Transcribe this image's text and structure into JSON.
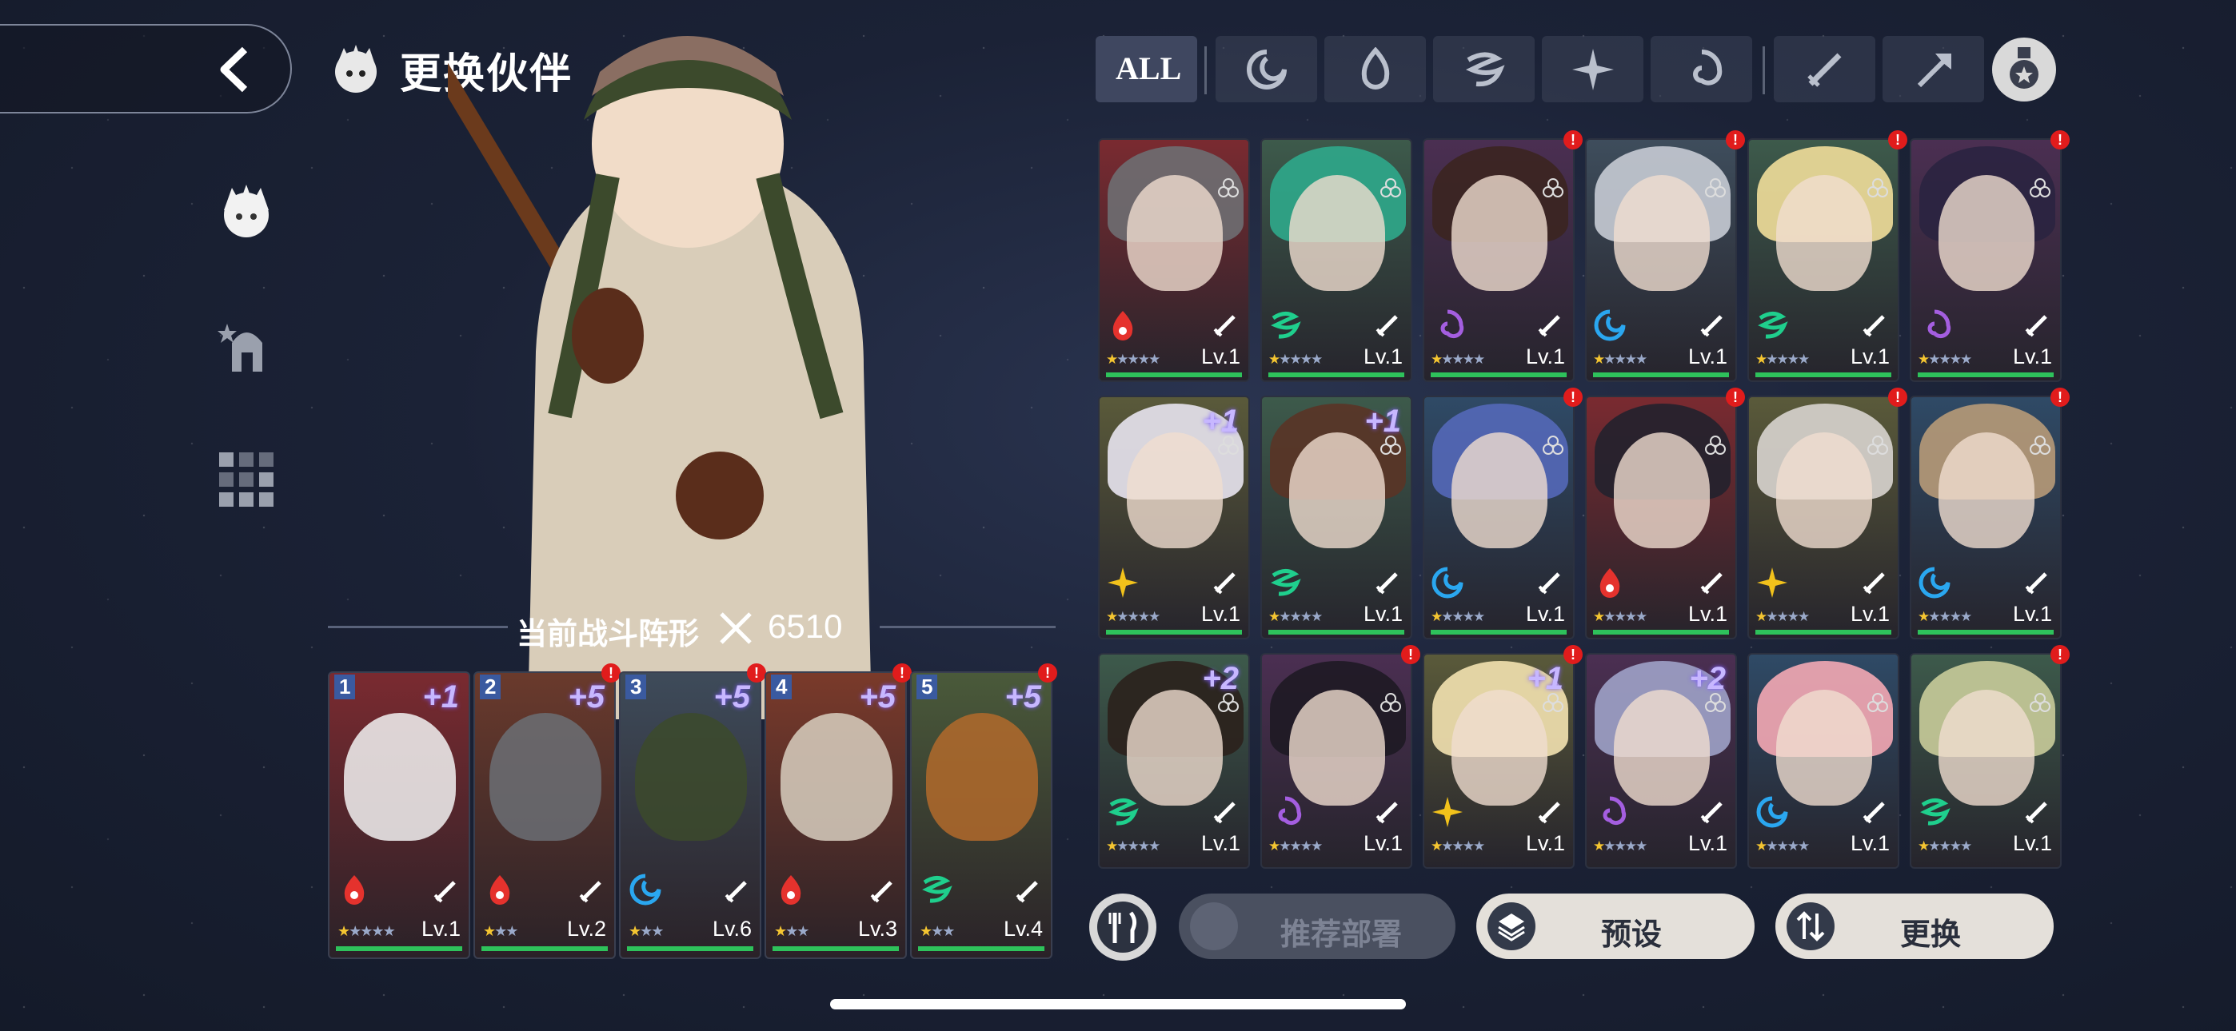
{
  "header": {
    "title": "更换伙伴"
  },
  "formation": {
    "label": "当前战斗阵形",
    "power": "6510"
  },
  "filters": {
    "all_label": "ALL",
    "element_icons": [
      "water-element-icon",
      "fire-element-icon",
      "wind-element-icon",
      "light-element-icon",
      "dark-element-icon"
    ],
    "class_icons": [
      "sword-class-icon",
      "axe-class-icon"
    ]
  },
  "team": [
    {
      "slot": "1",
      "plus": "+1",
      "level": "Lv.1",
      "element": "fire",
      "stars": "★★★★★",
      "lit": 1,
      "notify": false
    },
    {
      "slot": "2",
      "plus": "+5",
      "level": "Lv.2",
      "element": "fire",
      "stars": "★★★",
      "lit": 1,
      "notify": true
    },
    {
      "slot": "3",
      "plus": "+5",
      "level": "Lv.6",
      "element": "water",
      "stars": "★★★",
      "lit": 1,
      "notify": true
    },
    {
      "slot": "4",
      "plus": "+5",
      "level": "Lv.3",
      "element": "fire",
      "stars": "★★★",
      "lit": 1,
      "notify": true
    },
    {
      "slot": "5",
      "plus": "+5",
      "level": "Lv.4",
      "element": "wind",
      "stars": "★★★",
      "lit": 1,
      "notify": true
    }
  ],
  "roster": [
    {
      "plus": "",
      "level": "Lv.1",
      "element": "fire",
      "notify": false,
      "bg": "#7a2a30",
      "hair": "#6e6e72"
    },
    {
      "plus": "",
      "level": "Lv.1",
      "element": "wind",
      "notify": false,
      "bg": "#3d5a4b",
      "hair": "#2fa88b"
    },
    {
      "plus": "",
      "level": "Lv.1",
      "element": "dark",
      "notify": true,
      "bg": "#4b2f52",
      "hair": "#3b2520"
    },
    {
      "plus": "",
      "level": "Lv.1",
      "element": "water",
      "notify": true,
      "bg": "#3e4d5c",
      "hair": "#c7cbd4"
    },
    {
      "plus": "",
      "level": "Lv.1",
      "element": "wind",
      "notify": true,
      "bg": "#3d5a4b",
      "hair": "#f1de9a"
    },
    {
      "plus": "",
      "level": "Lv.1",
      "element": "dark",
      "notify": true,
      "bg": "#4b2f52",
      "hair": "#2a2440"
    },
    {
      "plus": "+1",
      "level": "Lv.1",
      "element": "light",
      "notify": false,
      "bg": "#5a5a3a",
      "hair": "#e8e4ef"
    },
    {
      "plus": "+1",
      "level": "Lv.1",
      "element": "wind",
      "notify": false,
      "bg": "#3d5a4b",
      "hair": "#5a3426"
    },
    {
      "plus": "",
      "level": "Lv.1",
      "element": "water",
      "notify": true,
      "bg": "#2f4a66",
      "hair": "#5468b8"
    },
    {
      "plus": "",
      "level": "Lv.1",
      "element": "fire",
      "notify": true,
      "bg": "#7a2a30",
      "hair": "#22212e"
    },
    {
      "plus": "",
      "level": "Lv.1",
      "element": "light",
      "notify": true,
      "bg": "#5a5a3a",
      "hair": "#d8d4cf"
    },
    {
      "plus": "",
      "level": "Lv.1",
      "element": "water",
      "notify": true,
      "bg": "#2f4a66",
      "hair": "#b79a78"
    },
    {
      "plus": "+2",
      "level": "Lv.1",
      "element": "wind",
      "notify": false,
      "bg": "#3d5a4b",
      "hair": "#2b211c"
    },
    {
      "plus": "",
      "level": "Lv.1",
      "element": "dark",
      "notify": true,
      "bg": "#4b2f52",
      "hair": "#1e1a24"
    },
    {
      "plus": "+1",
      "level": "Lv.1",
      "element": "light",
      "notify": true,
      "bg": "#5a5a3a",
      "hair": "#f3e2b0"
    },
    {
      "plus": "+2",
      "level": "Lv.1",
      "element": "dark",
      "notify": false,
      "bg": "#4b2f52",
      "hair": "#9ea2c8"
    },
    {
      "plus": "",
      "level": "Lv.1",
      "element": "water",
      "notify": false,
      "bg": "#2f4a66",
      "hair": "#f4a8b4"
    },
    {
      "plus": "",
      "level": "Lv.1",
      "element": "wind",
      "notify": true,
      "bg": "#3d5a4b",
      "hair": "#c9cc9a"
    }
  ],
  "buttons": {
    "recommend": "推荐部署",
    "preset": "预设",
    "swap": "更换"
  },
  "colors": {
    "fire": "#e5322d",
    "water": "#2aa7f0",
    "wind": "#1fcf8d",
    "light": "#f2c21b",
    "dark": "#a45ee0",
    "level_bar": "#2ec25b",
    "star_lit": "#f4c531",
    "star_dim": "#9aa9c9"
  }
}
